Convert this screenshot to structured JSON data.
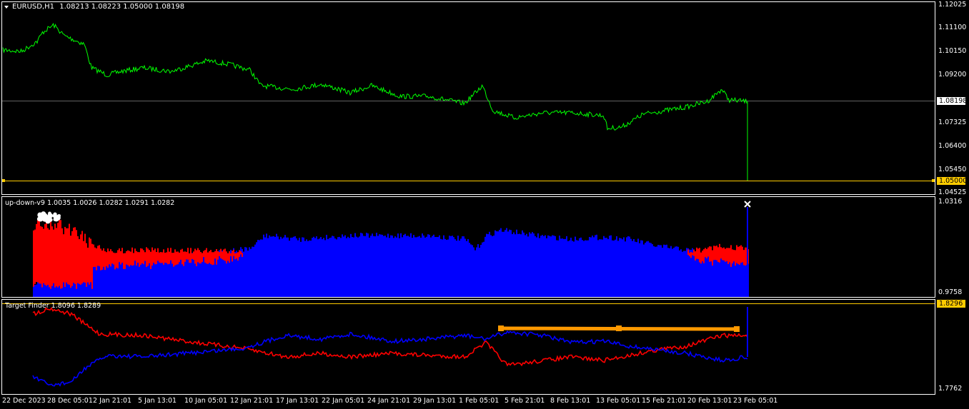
{
  "main": {
    "symbol_label": "EURUSD,H1",
    "ohlc_label": "1.08213 1.08223 1.05000 1.08198",
    "price_scale": [
      "1.12025",
      "1.11100",
      "1.10150",
      "1.09200",
      "1.08198",
      "1.07325",
      "1.06400",
      "1.05450",
      "1.05000",
      "1.04525"
    ],
    "current_price": "1.08198",
    "hline_price": "1.05000",
    "line_color": "#00ff00",
    "accent_color": "#ffcc00"
  },
  "indicator1": {
    "title": "up-down-v9 1.0035 1.0026 1.0282 1.0291 1.0282",
    "scale_top": "1.0316",
    "scale_bottom": "0.9758",
    "up_color": "#0000ff",
    "down_color": "#ff0000",
    "close_icon": "x-icon"
  },
  "indicator2": {
    "title": "Target Finder 1.8096 1.8289",
    "scale_top": "1.8296",
    "scale_bottom": "1.7762",
    "line1_color": "#ff0000",
    "line2_color": "#0000ff",
    "target_color": "#ff9900"
  },
  "time_axis": [
    "22 Dec 2023",
    "28 Dec 05:01",
    "2 Jan 21:01",
    "5 Jan 13:01",
    "10 Jan 05:01",
    "12 Jan 21:01",
    "17 Jan 13:01",
    "22 Jan 05:01",
    "24 Jan 21:01",
    "29 Jan 13:01",
    "1 Feb 05:01",
    "5 Feb 21:01",
    "8 Feb 13:01",
    "13 Feb 05:01",
    "15 Feb 21:01",
    "20 Feb 13:01",
    "23 Feb 05:01"
  ]
}
